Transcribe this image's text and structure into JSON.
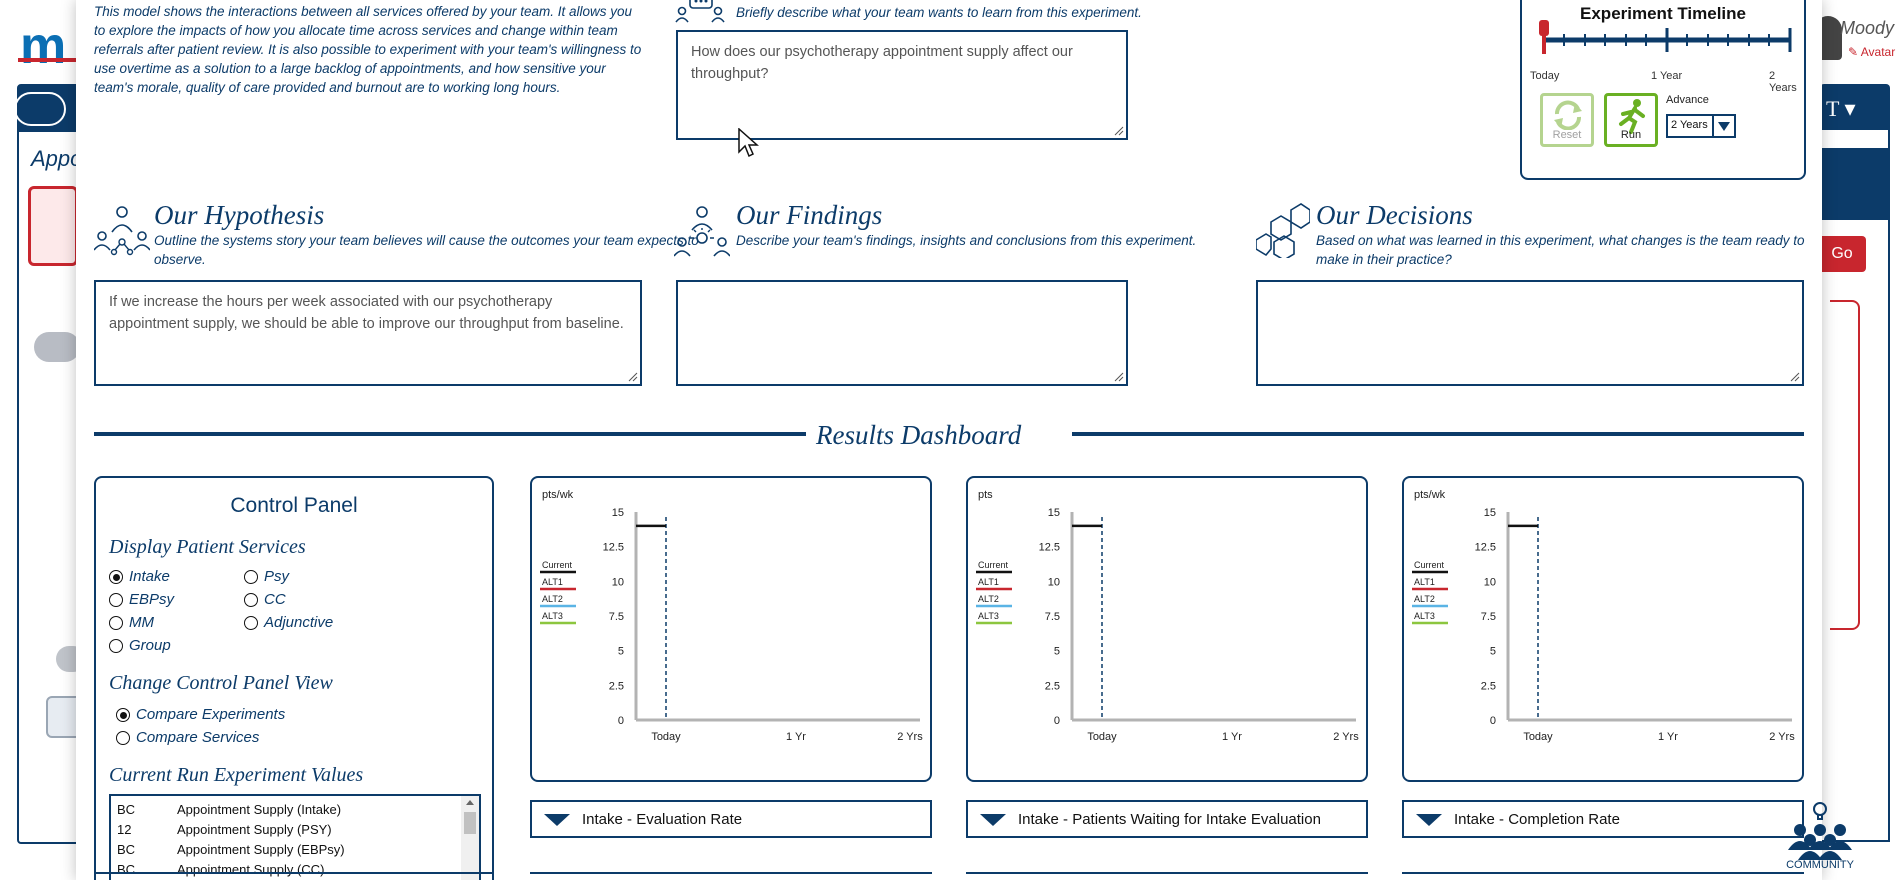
{
  "background": {
    "logo": "m",
    "left_panel_text": "Appo",
    "user_name": "Moody",
    "user_avatar_link": "Avatar",
    "go_button": "Go",
    "tool_icon": "T"
  },
  "intro": {
    "text": "This model shows the interactions between all services offered by your team. It allows you to explore the impacts of how you allocate time across services and change within team referrals after patient review. It is also possible to experiment with your team's willingness to use overtime as a solution to a large backlog of appointments, and how sensitive your team's morale, quality of care provided and burnout are to working long hours."
  },
  "question": {
    "subtitle": "Briefly describe what your team wants to learn from this experiment.",
    "value": "How does our psychotherapy appointment supply affect our throughput?"
  },
  "hypothesis": {
    "title": "Our Hypothesis",
    "subtitle": "Outline the systems story your team believes will cause the outcomes your team expects to observe.",
    "value": "If we increase the hours per week associated with our psychotherapy appointment supply, we should be able to improve our throughput from baseline."
  },
  "findings": {
    "title": "Our Findings",
    "subtitle": "Describe your team's findings, insights and conclusions from this experiment.",
    "value": ""
  },
  "decisions": {
    "title": "Our Decisions",
    "subtitle": "Based on what was learned in this experiment, what changes is the team ready to make in their practice?",
    "value": ""
  },
  "timeline": {
    "title": "Experiment Timeline",
    "labels": [
      "Today",
      "1 Year",
      "2 Years"
    ],
    "progress": 0,
    "reset_label": "Reset",
    "run_label": "Run",
    "advance_label": "Advance",
    "advance_value": "2 Years"
  },
  "results": {
    "title": "Results Dashboard"
  },
  "control_panel": {
    "title": "Control Panel",
    "display_heading": "Display Patient Services",
    "services": [
      {
        "label": "Intake",
        "selected": true
      },
      {
        "label": "Psy",
        "selected": false
      },
      {
        "label": "EBPsy",
        "selected": false
      },
      {
        "label": "CC",
        "selected": false
      },
      {
        "label": "MM",
        "selected": false
      },
      {
        "label": "Adjunctive",
        "selected": false
      },
      {
        "label": "Group",
        "selected": false
      }
    ],
    "view_heading": "Change Control Panel View",
    "views": [
      {
        "label": "Compare Experiments",
        "selected": true
      },
      {
        "label": "Compare Services",
        "selected": false
      }
    ],
    "values_heading": "Current Run Experiment Values",
    "values": [
      {
        "code": "BC",
        "name": "Appointment Supply (Intake)"
      },
      {
        "code": "12",
        "name": "Appointment Supply (PSY)"
      },
      {
        "code": "BC",
        "name": "Appointment Supply (EBPsy)"
      },
      {
        "code": "BC",
        "name": "Appointment Supply (CC)"
      }
    ]
  },
  "chart_data": [
    {
      "type": "line",
      "unit": "pts/wk",
      "yticks": [
        "15",
        "12.5",
        "10",
        "7.5",
        "5",
        "2.5",
        "0"
      ],
      "ylim": [
        0,
        15
      ],
      "xticks": [
        "Today",
        "1 Yr",
        "2 Yrs"
      ],
      "legend": [
        "Current",
        "ALT1",
        "ALT2",
        "ALT3"
      ],
      "legend_colors": [
        "#111111",
        "#c8262e",
        "#5ab4e5",
        "#8cc63f"
      ],
      "series": [
        {
          "name": "Current",
          "values": [
            14,
            14
          ]
        }
      ],
      "dropdown": "Intake - Evaluation Rate"
    },
    {
      "type": "line",
      "unit": "pts",
      "yticks": [
        "15",
        "12.5",
        "10",
        "7.5",
        "5",
        "2.5",
        "0"
      ],
      "ylim": [
        0,
        15
      ],
      "xticks": [
        "Today",
        "1 Yr",
        "2 Yrs"
      ],
      "legend": [
        "Current",
        "ALT1",
        "ALT2",
        "ALT3"
      ],
      "legend_colors": [
        "#111111",
        "#c8262e",
        "#5ab4e5",
        "#8cc63f"
      ],
      "series": [
        {
          "name": "Current",
          "values": [
            14,
            14
          ]
        }
      ],
      "dropdown": "Intake - Patients Waiting for Intake Evaluation"
    },
    {
      "type": "line",
      "unit": "pts/wk",
      "yticks": [
        "15",
        "12.5",
        "10",
        "7.5",
        "5",
        "2.5",
        "0"
      ],
      "ylim": [
        0,
        15
      ],
      "xticks": [
        "Today",
        "1 Yr",
        "2 Yrs"
      ],
      "legend": [
        "Current",
        "ALT1",
        "ALT2",
        "ALT3"
      ],
      "legend_colors": [
        "#111111",
        "#c8262e",
        "#5ab4e5",
        "#8cc63f"
      ],
      "series": [
        {
          "name": "Current",
          "values": [
            14,
            14
          ]
        }
      ],
      "dropdown": "Intake - Completion Rate"
    }
  ],
  "community": {
    "label": "COMMUNITY"
  },
  "colors": {
    "navy": "#0c3b69",
    "red": "#c8262e",
    "green": "#6ab023"
  }
}
